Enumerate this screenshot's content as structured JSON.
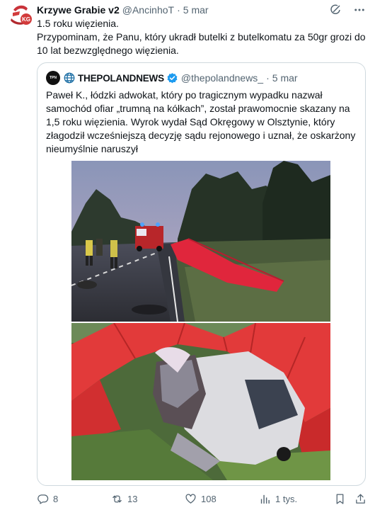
{
  "tweet": {
    "author": {
      "display_name": "Krzywe Grabie v2",
      "handle": "@AncinhoT",
      "date": "5 mar",
      "avatar_text": "KG"
    },
    "text_lines": [
      "1.5 roku więzienia.",
      "Przypominam, że Panu, który ukradł butelki z butelkomatu za 50gr grozi do 10 lat bezwzględnego więzienia."
    ],
    "header_icons": [
      "grok-icon",
      "more-icon"
    ]
  },
  "quote": {
    "avatar_text": "TPN",
    "name": "THEPOLANDNEWS",
    "handle": "@thepolandnews_",
    "date": "5 mar",
    "text": "Paweł K., łódzki adwokat, który po tragicznym wypadku nazwał samochód ofiar „trumną na kółkach”, został prawomocnie skazany na 1,5 roku więzienia. Wyrok wydał Sąd Okręgowy w Olsztynie, który złagodził wcześniejszą decyzję sądu rejonowego i uznał, że oskarżony nieumyślnie naruszył",
    "verified_color": "#1d9bf0"
  },
  "actions": {
    "replies": "8",
    "reposts": "13",
    "likes": "108",
    "views": "1 tys."
  },
  "colors": {
    "text": "#0f1419",
    "muted": "#536471",
    "border": "#cfd9de",
    "accent": "#1d9bf0"
  }
}
